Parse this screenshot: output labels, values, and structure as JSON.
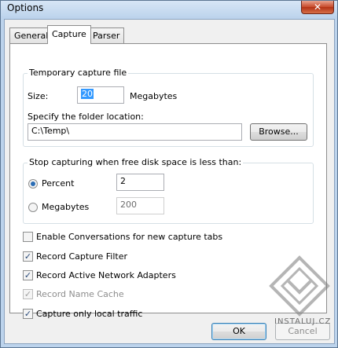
{
  "window": {
    "title": "Options",
    "close_glyph": "✕"
  },
  "tabs": [
    {
      "label": "General",
      "active": false
    },
    {
      "label": "Capture",
      "active": true
    },
    {
      "label": "Parser",
      "active": false
    }
  ],
  "temp_file": {
    "group_label": "Temporary capture file",
    "size_label": "Size:",
    "size_value": "20",
    "size_unit": "Megabytes",
    "folder_label": "Specify the folder location:",
    "folder_value": "C:\\Temp\\",
    "browse_label": "Browse..."
  },
  "stop_capture": {
    "group_label": "Stop capturing when free disk space is less than:",
    "percent_label": "Percent",
    "percent_value": "2",
    "megabytes_label": "Megabytes",
    "megabytes_value": "200"
  },
  "options": [
    {
      "label": "Enable Conversations for new capture tabs",
      "checked": false,
      "disabled": false
    },
    {
      "label": "Record Capture Filter",
      "checked": true,
      "disabled": false
    },
    {
      "label": "Record Active Network Adapters",
      "checked": true,
      "disabled": false
    },
    {
      "label": "Record Name Cache",
      "checked": true,
      "disabled": true
    },
    {
      "label": "Capture only local traffic",
      "checked": true,
      "disabled": false
    }
  ],
  "footer": {
    "ok_label": "OK",
    "cancel_label": "Cancel"
  },
  "watermark": {
    "text": "INSTALUJ.CZ"
  },
  "colors": {
    "accent": "#3399ff",
    "radio_dot": "#2a6db5",
    "close": "#c7492a"
  }
}
